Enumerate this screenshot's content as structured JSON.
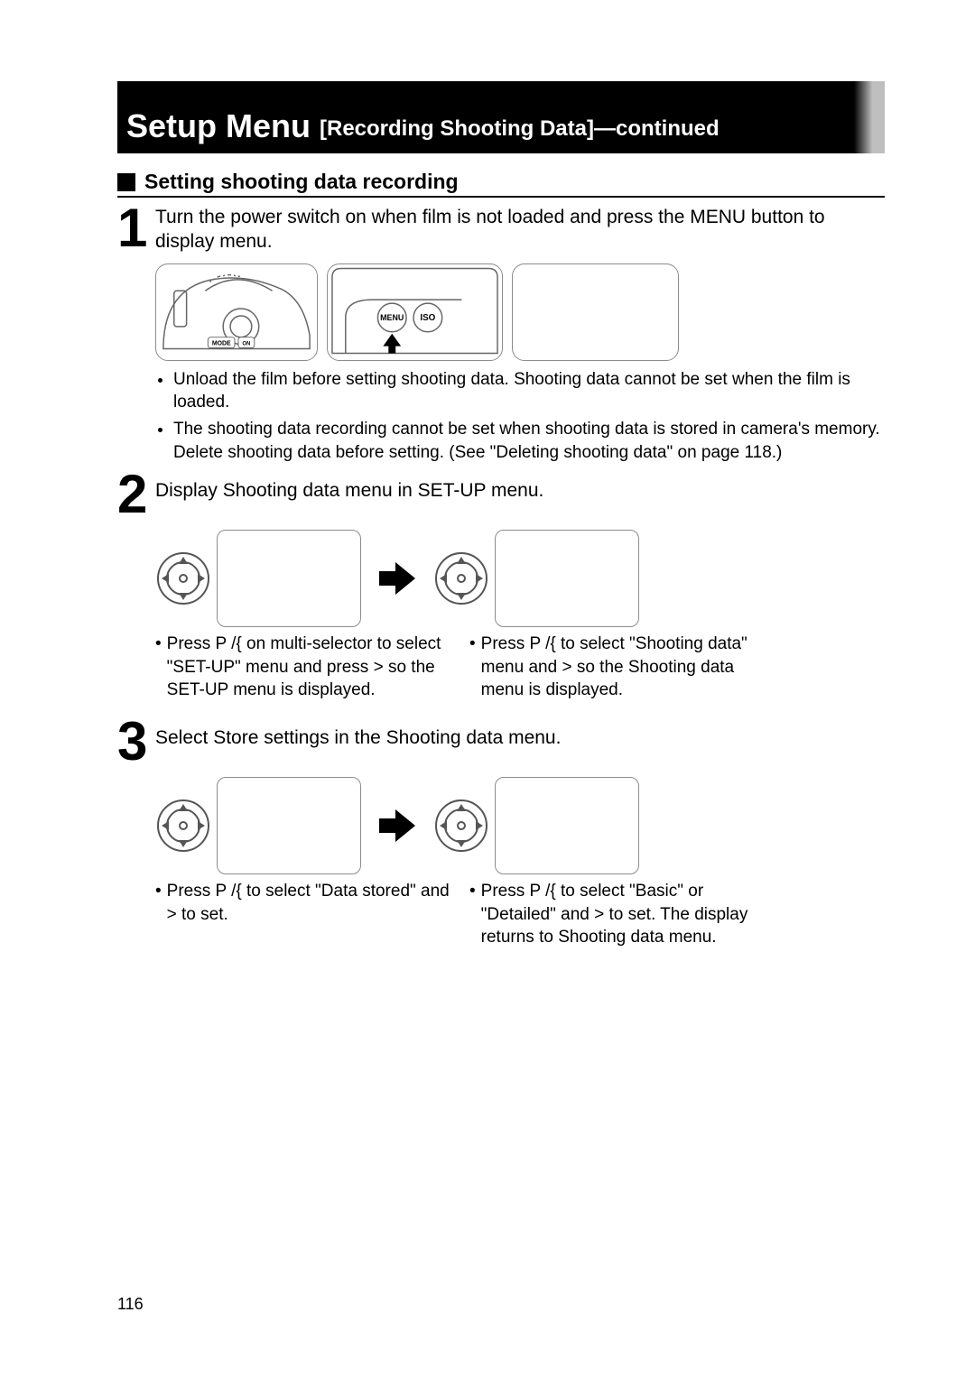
{
  "titlebar": {
    "main": "Setup Menu",
    "sub": "[Recording Shooting Data]—continued"
  },
  "subhead": "Setting shooting data recording",
  "step1": "Turn the power switch on when film is not loaded and press the MENU button to display menu.",
  "diagram1": {
    "menu_label": "MENU",
    "iso_label": "ISO",
    "mode_label": "MODE",
    "on_label": "ON"
  },
  "step1_bullets": [
    "Unload the film before setting shooting data. Shooting data cannot be set when the film is loaded.",
    "The shooting data recording cannot be set when shooting data is stored in camera's memory. Delete shooting data before setting. (See \"Deleting shooting data\" on page 118.)"
  ],
  "step2": "Display Shooting data menu in SET-UP menu.",
  "step2_caption_left": "Press P /{  on multi-selector to select \"SET-UP\" menu and press >  so the SET-UP menu is displayed.",
  "step2_caption_right": "Press P /{  to select \"Shooting data\" menu and >  so the Shooting data menu is displayed.",
  "step3": "Select Store settings in the Shooting data menu.",
  "step3_caption_left": "Press P /{  to select \"Data stored\" and >  to set.",
  "step3_caption_right": "Press P /{  to select \"Basic\" or \"Detailed\" and >  to set. The display returns to Shooting data menu.",
  "page_number": "116"
}
